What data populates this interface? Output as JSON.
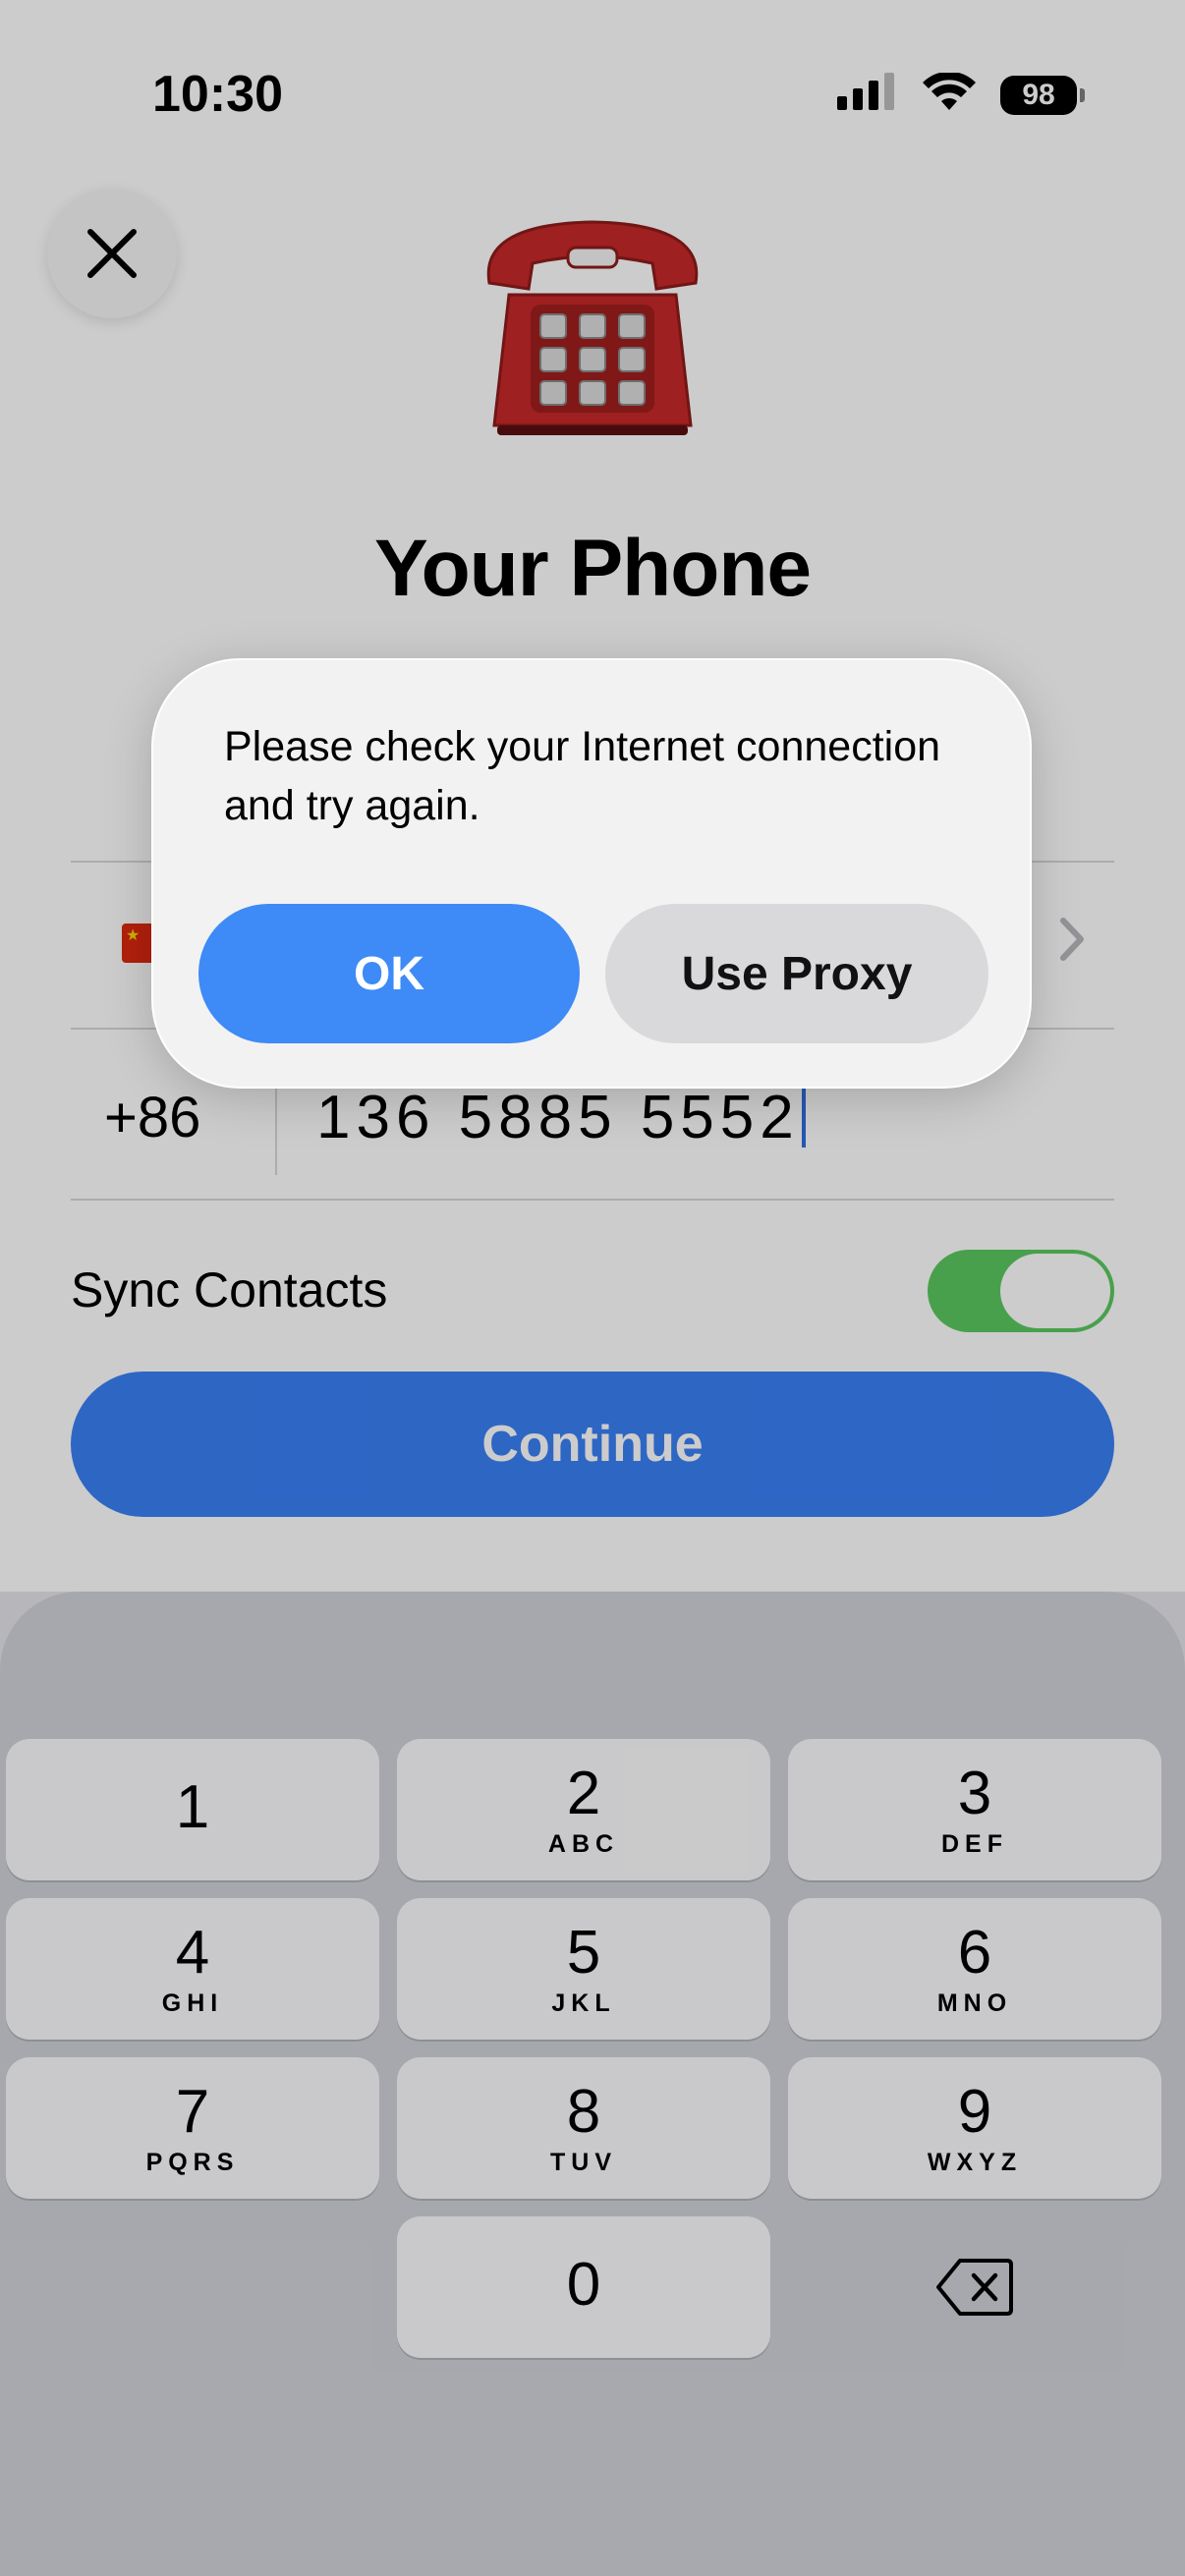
{
  "status_bar": {
    "time": "10:30",
    "battery": "98",
    "icons": [
      "cellular-signal-icon",
      "wifi-icon",
      "battery-icon"
    ]
  },
  "header": {
    "close_icon": "close-icon",
    "illustration": "telephone-icon",
    "title": "Your Phone"
  },
  "form": {
    "country_flag": "china-flag-icon",
    "country_chevron": "chevron-right-icon",
    "country_code": "+86",
    "phone_number": "136 5885 5552",
    "sync_contacts_label": "Sync Contacts",
    "sync_contacts_on": true,
    "continue_label": "Continue"
  },
  "keyboard": {
    "keys": [
      {
        "num": "1",
        "letters": ""
      },
      {
        "num": "2",
        "letters": "ABC"
      },
      {
        "num": "3",
        "letters": "DEF"
      },
      {
        "num": "4",
        "letters": "GHI"
      },
      {
        "num": "5",
        "letters": "JKL"
      },
      {
        "num": "6",
        "letters": "MNO"
      },
      {
        "num": "7",
        "letters": "PQRS"
      },
      {
        "num": "8",
        "letters": "TUV"
      },
      {
        "num": "9",
        "letters": "WXYZ"
      },
      {
        "num": "0",
        "letters": ""
      }
    ],
    "backspace_icon": "backspace-icon"
  },
  "alert": {
    "message": "Please check your Internet connection and try again.",
    "ok_label": "OK",
    "proxy_label": "Use Proxy"
  },
  "colors": {
    "accent": "#3e8af6",
    "toggle_on": "#5ac85f"
  }
}
